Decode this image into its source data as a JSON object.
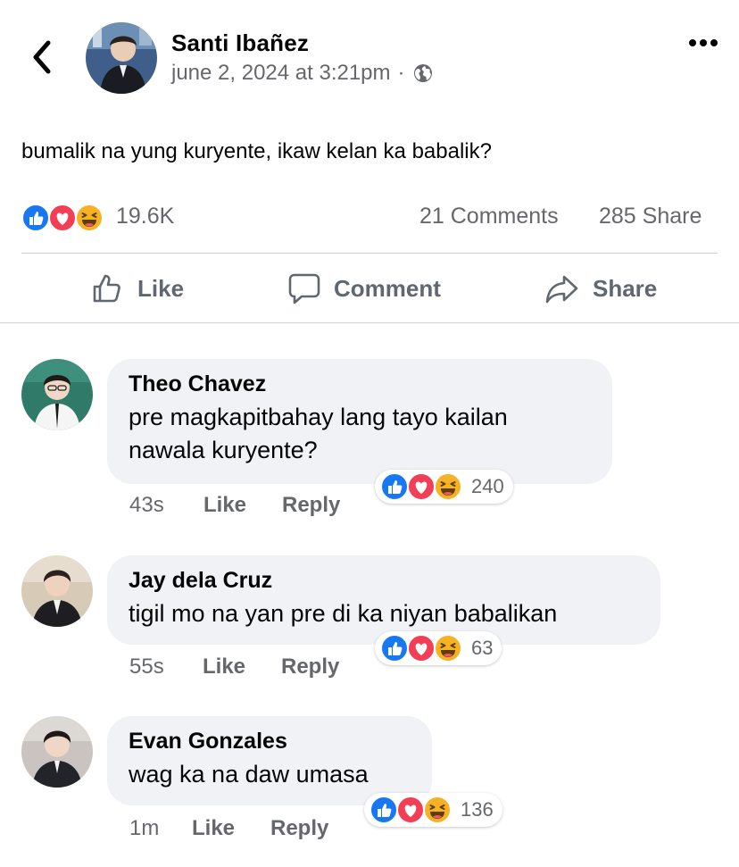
{
  "post": {
    "author": "Santi Ibañez",
    "timestamp": "june 2, 2024 at 3:21pm",
    "separator": "·",
    "audience_icon": "globe-icon",
    "text": "bumalik na yung kuryente, ikaw kelan ka babalik?",
    "reactions": [
      "like-reaction-icon",
      "love-reaction-icon",
      "haha-reaction-icon"
    ],
    "reaction_count": "19.6K",
    "comments_count": "21 Comments",
    "share_count": "285 Share"
  },
  "actions": {
    "like": "Like",
    "comment": "Comment",
    "share": "Share"
  },
  "colors": {
    "like_blue": "#1877f2",
    "love_red": "#f33e58",
    "haha_yellow": "#f7b125",
    "secondary_text": "#65676b",
    "bubble_bg": "#f0f2f5"
  },
  "comments": [
    {
      "name": "Theo Chavez",
      "text_lines": [
        "pre magkapitbahay lang tayo kailan",
        "nawala kuryente?"
      ],
      "time": "43s",
      "like": "Like",
      "reply": "Reply",
      "reaction_count": "240"
    },
    {
      "name": "Jay dela Cruz",
      "text_lines": [
        "tigil mo na yan pre di ka niyan babalikan"
      ],
      "time": "55s",
      "like": "Like",
      "reply": "Reply",
      "reaction_count": "63"
    },
    {
      "name": "Evan Gonzales",
      "text_lines": [
        "wag ka na daw umasa"
      ],
      "time": "1m",
      "like": "Like",
      "reply": "Reply",
      "reaction_count": "136"
    }
  ]
}
